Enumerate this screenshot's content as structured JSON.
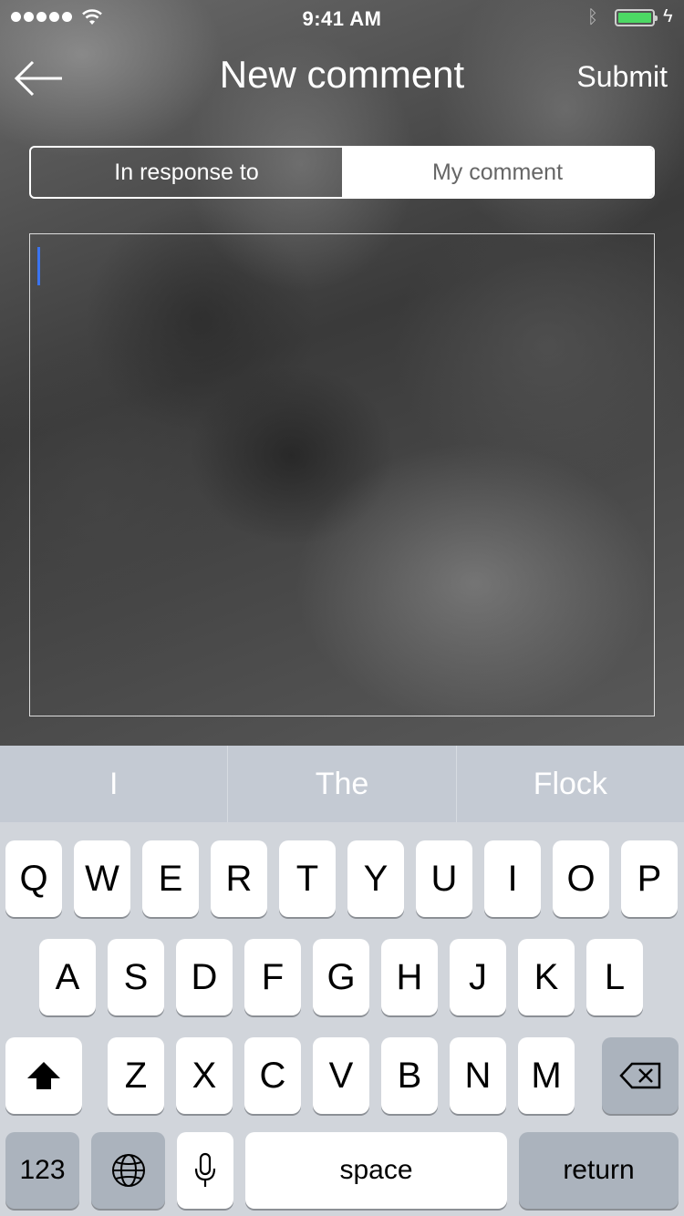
{
  "status_bar": {
    "time": "9:41 AM",
    "bluetooth_icon": "bluetooth-icon",
    "battery_color": "#4cd964"
  },
  "navbar": {
    "title": "New comment",
    "submit_label": "Submit",
    "back_icon": "back-arrow-icon"
  },
  "segmented": {
    "left_label": "In response to",
    "right_label": "My comment",
    "selected": "My comment"
  },
  "comment": {
    "value": ""
  },
  "keyboard": {
    "suggestions": [
      "I",
      "The",
      "Flock"
    ],
    "row1": [
      "Q",
      "W",
      "E",
      "R",
      "T",
      "Y",
      "U",
      "I",
      "O",
      "P"
    ],
    "row2": [
      "A",
      "S",
      "D",
      "F",
      "G",
      "H",
      "J",
      "K",
      "L"
    ],
    "row3": [
      "Z",
      "X",
      "C",
      "V",
      "B",
      "N",
      "M"
    ],
    "numbers_label": "123",
    "space_label": "space",
    "return_label": "return"
  }
}
